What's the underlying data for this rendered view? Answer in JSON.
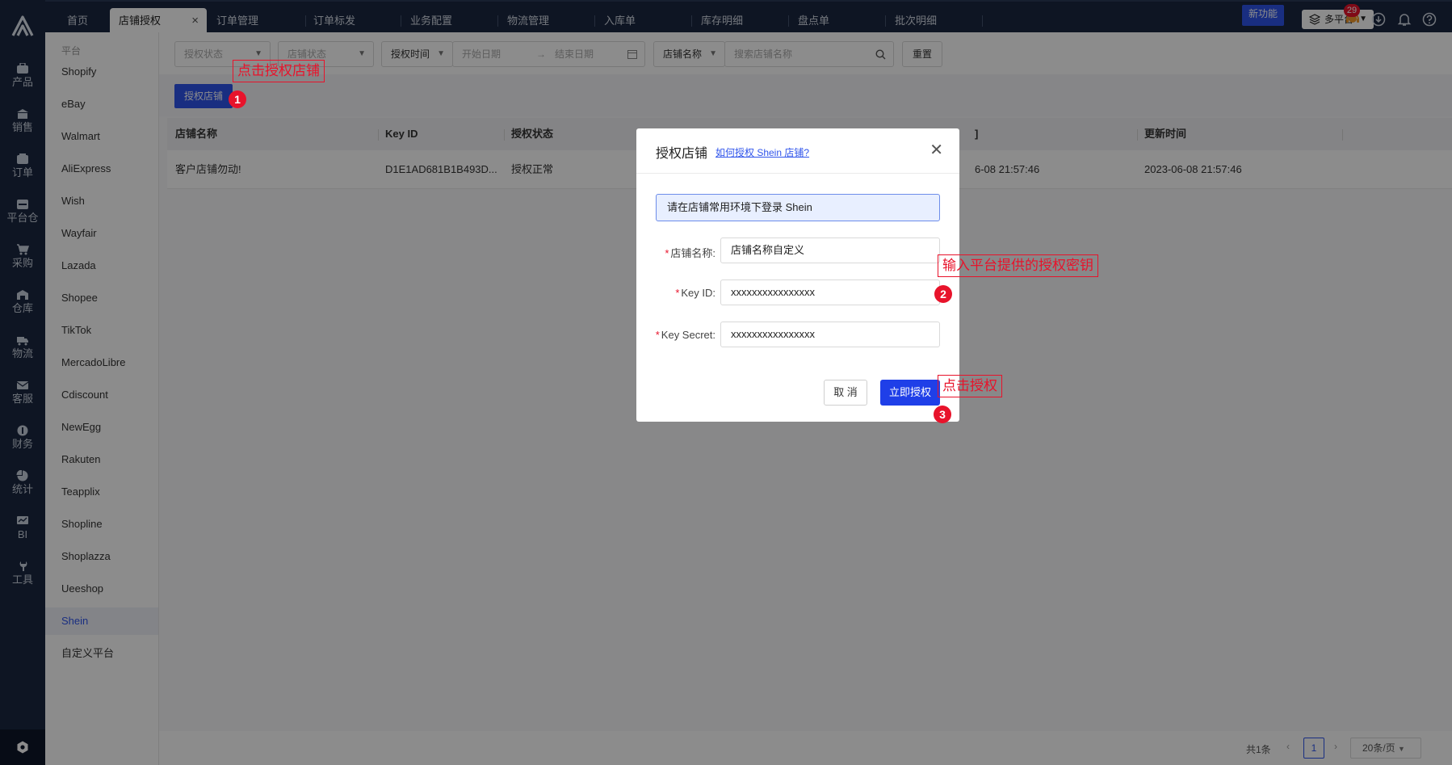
{
  "rail": {
    "items": [
      {
        "label": "产品",
        "icon": "product-icon"
      },
      {
        "label": "销售",
        "icon": "sales-icon"
      },
      {
        "label": "订单",
        "icon": "order-icon"
      },
      {
        "label": "平台仓",
        "icon": "platform-warehouse-icon"
      },
      {
        "label": "采购",
        "icon": "cart-icon"
      },
      {
        "label": "仓库",
        "icon": "warehouse-icon"
      },
      {
        "label": "物流",
        "icon": "truck-icon"
      },
      {
        "label": "客服",
        "icon": "mail-icon"
      },
      {
        "label": "财务",
        "icon": "finance-icon"
      },
      {
        "label": "统计",
        "icon": "pie-chart-icon"
      },
      {
        "label": "BI",
        "icon": "bi-icon"
      },
      {
        "label": "工具",
        "icon": "wrench-icon"
      }
    ]
  },
  "tabs": [
    {
      "label": "首页"
    },
    {
      "label": "店铺授权",
      "active": true
    },
    {
      "label": "订单管理"
    },
    {
      "label": "订单标发"
    },
    {
      "label": "业务配置"
    },
    {
      "label": "物流管理"
    },
    {
      "label": "入库单"
    },
    {
      "label": "库存明细"
    },
    {
      "label": "盘点单"
    },
    {
      "label": "批次明细"
    }
  ],
  "header": {
    "new_feature": "新功能",
    "platform_select": "多平台",
    "notification_count": "29"
  },
  "sidebar": {
    "title": "平台",
    "items": [
      {
        "label": "Shopify"
      },
      {
        "label": "eBay"
      },
      {
        "label": "Walmart"
      },
      {
        "label": "AliExpress"
      },
      {
        "label": "Wish"
      },
      {
        "label": "Wayfair"
      },
      {
        "label": "Lazada"
      },
      {
        "label": "Shopee"
      },
      {
        "label": "TikTok"
      },
      {
        "label": "MercadoLibre"
      },
      {
        "label": "Cdiscount"
      },
      {
        "label": "NewEgg"
      },
      {
        "label": "Rakuten"
      },
      {
        "label": "Teapplix"
      },
      {
        "label": "Shopline"
      },
      {
        "label": "Shoplazza"
      },
      {
        "label": "Ueeshop"
      },
      {
        "label": "Shein",
        "active": true
      },
      {
        "label": "自定义平台"
      }
    ]
  },
  "filters": {
    "auth_status_placeholder": "授权状态",
    "shop_status_placeholder": "店铺状态",
    "auth_time_label": "授权时间",
    "start_date_placeholder": "开始日期",
    "end_date_placeholder": "结束日期",
    "shop_name_label": "店铺名称",
    "search_placeholder": "搜索店铺名称",
    "reset_label": "重置"
  },
  "actions": {
    "authorize_shop_label": "授权店铺"
  },
  "table": {
    "columns": [
      "店铺名称",
      "Key ID",
      "授权状态",
      "",
      "]",
      "更新时间"
    ],
    "rows": [
      {
        "shop_name": "客户店铺勿动!",
        "key_id": "D1E1AD681B1B493D...",
        "status": "授权正常",
        "created_partial": "6-08 21:57:46",
        "updated": "2023-06-08 21:57:46"
      }
    ]
  },
  "pager": {
    "total": "共1条",
    "current_page": "1",
    "page_size": "20条/页"
  },
  "modal": {
    "title": "授权店铺",
    "help_link": "如何授权 Shein 店铺?",
    "notice": "请在店铺常用环境下登录 Shein",
    "fields": [
      {
        "label": "店铺名称:",
        "value": "店铺名称自定义"
      },
      {
        "label": "Key ID:",
        "value": "xxxxxxxxxxxxxxxx"
      },
      {
        "label": "Key Secret:",
        "value": "xxxxxxxxxxxxxxxx"
      }
    ],
    "cancel_label": "取 消",
    "confirm_label": "立即授权"
  },
  "annotations": {
    "step1_text": "点击授权店铺",
    "step1_num": "1",
    "step2_text": "输入平台提供的授权密钥",
    "step2_num": "2",
    "step3_text": "点击授权",
    "step3_num": "3"
  },
  "colors": {
    "primary": "#2f54eb",
    "nav_bg": "#1b2740",
    "annotation": "#e8132b"
  }
}
